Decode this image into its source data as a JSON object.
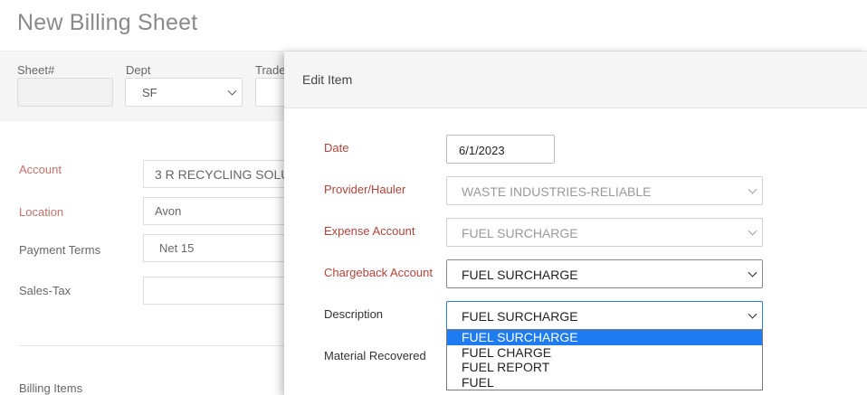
{
  "page": {
    "title": "New Billing Sheet"
  },
  "top_fields": {
    "sheet_label": "Sheet#",
    "sheet_value": "",
    "dept_label": "Dept",
    "dept_value": "SF",
    "trade_label": "Trade"
  },
  "account_section": {
    "account_label": "Account",
    "account_value": "3 R RECYCLING SOLU",
    "location_label": "Location",
    "location_value": "Avon",
    "payment_terms_label": "Payment Terms",
    "payment_terms_value": "Net 15",
    "sales_tax_label": "Sales-Tax",
    "sales_tax_value": "",
    "billing_items_label": "Billing Items"
  },
  "modal": {
    "title": "Edit Item",
    "date_label": "Date",
    "date_value": "6/1/2023",
    "provider_label": "Provider/Hauler",
    "provider_value": "WASTE INDUSTRIES-RELIABLE",
    "expense_label": "Expense Account",
    "expense_value": "FUEL SURCHARGE",
    "chargeback_label": "Chargeback Account",
    "chargeback_value": "FUEL SURCHARGE",
    "description_label": "Description",
    "description_value": "FUEL SURCHARGE",
    "description_options": [
      "FUEL SURCHARGE",
      "FUEL CHARGE",
      "FUEL REPORT",
      "FUEL"
    ],
    "material_label": "Material Recovered"
  },
  "colors": {
    "required_label": "#b0443a",
    "focus_border": "#2f7bd8",
    "selected_option": "#1e7cf0"
  },
  "icons": [
    "chevron-down-icon"
  ]
}
